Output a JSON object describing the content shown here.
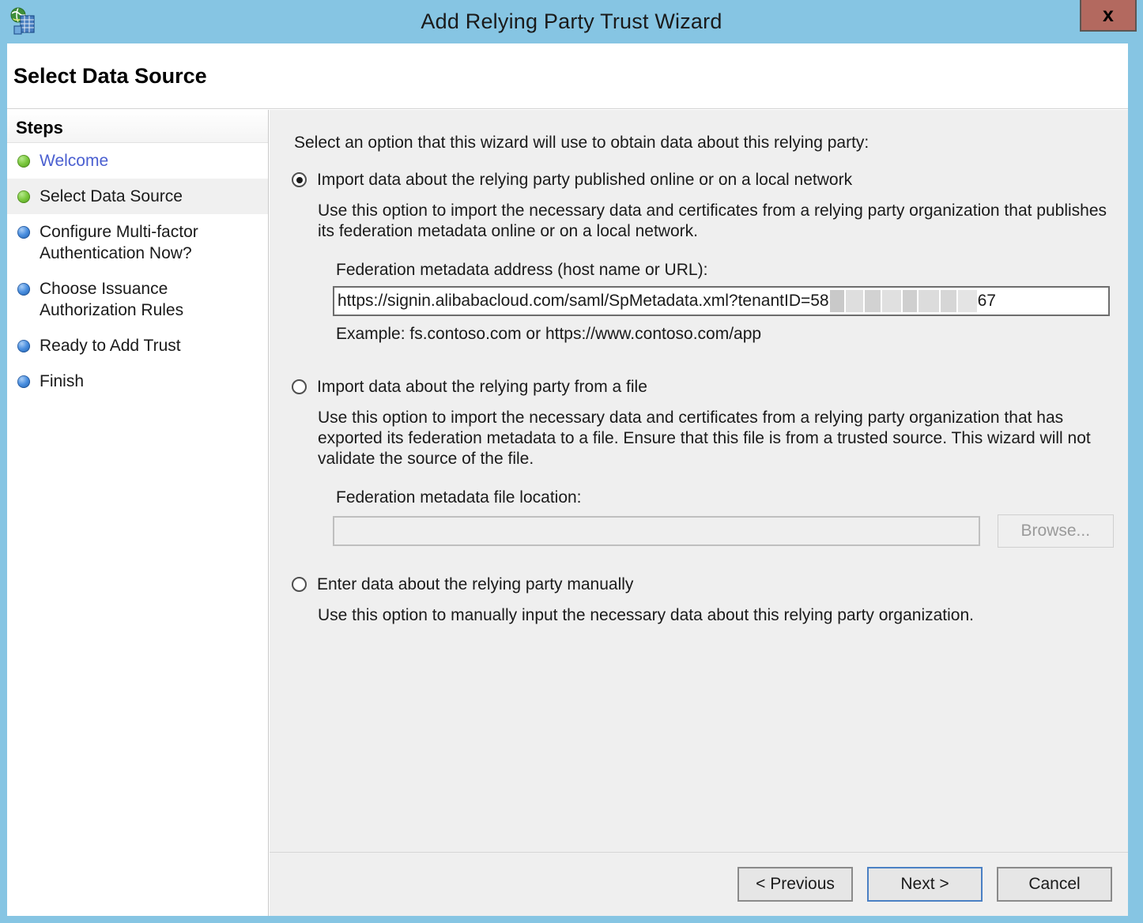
{
  "window": {
    "title": "Add Relying Party Trust Wizard",
    "icon": "adfs-globe-network-icon",
    "close_label": "x",
    "accent_color": "#86c5e3",
    "close_button_color": "#b3695f"
  },
  "page": {
    "header_title": "Select Data Source"
  },
  "sidebar": {
    "header": "Steps",
    "items": [
      {
        "label": "Welcome",
        "bullet": "green",
        "state": "completed-link"
      },
      {
        "label": "Select Data Source",
        "bullet": "green",
        "state": "current"
      },
      {
        "label": "Configure Multi-factor Authentication Now?",
        "bullet": "blue",
        "state": "pending"
      },
      {
        "label": "Choose Issuance Authorization Rules",
        "bullet": "blue",
        "state": "pending"
      },
      {
        "label": "Ready to Add Trust",
        "bullet": "blue",
        "state": "pending"
      },
      {
        "label": "Finish",
        "bullet": "blue",
        "state": "pending"
      }
    ]
  },
  "main": {
    "intro": "Select an option that this wizard will use to obtain data about this relying party:",
    "options": [
      {
        "label": "Import data about the relying party published online or on a local network",
        "selected": true,
        "description": "Use this option to import the necessary data and certificates from a relying party organization that publishes its federation metadata online or on a local network.",
        "field_label": "Federation metadata address (host name or URL):",
        "field_value_prefix": "https://signin.alibabacloud.com/saml/SpMetadata.xml?tenantID=58",
        "field_value_suffix": "67",
        "field_redacted": true,
        "example": "Example: fs.contoso.com or https://www.contoso.com/app"
      },
      {
        "label": "Import data about the relying party from a file",
        "selected": false,
        "description": "Use this option to import the necessary data and certificates from a relying party organization that has exported its federation metadata to a file. Ensure that this file is from a trusted source.  This wizard will not validate the source of the file.",
        "field_label": "Federation metadata file location:",
        "field_value": "",
        "browse_label": "Browse...",
        "disabled": true
      },
      {
        "label": "Enter data about the relying party manually",
        "selected": false,
        "description": "Use this option to manually input the necessary data about this relying party organization."
      }
    ]
  },
  "footer": {
    "previous_label": "< Previous",
    "next_label": "Next >",
    "cancel_label": "Cancel"
  }
}
